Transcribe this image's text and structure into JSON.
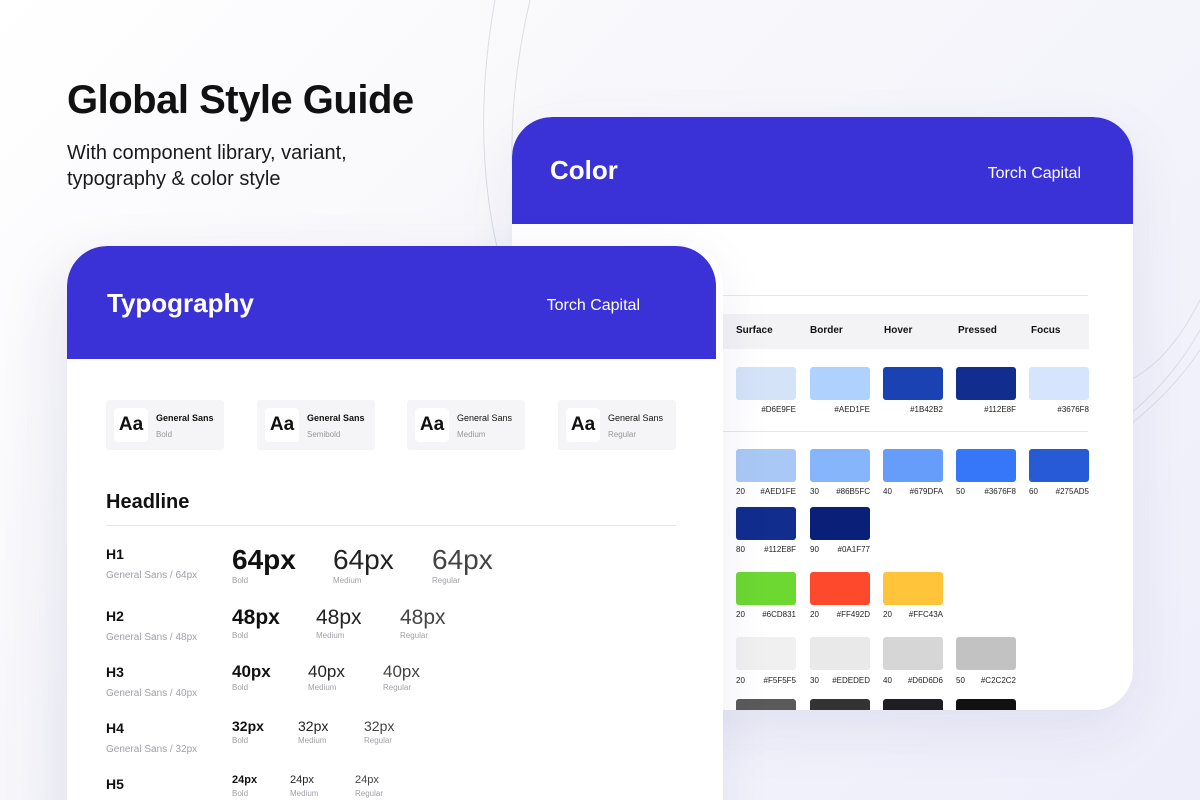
{
  "hero": {
    "title": "Global Style Guide",
    "subtitle_line1": "With component library, variant,",
    "subtitle_line2": "typography & color style"
  },
  "colors": {
    "brand_blue": "#3a32d6"
  },
  "color_card": {
    "title": "Color",
    "brand": "Torch Capital",
    "columns": [
      "Surface",
      "Border",
      "Hover",
      "Pressed",
      "Focus"
    ],
    "state_row": [
      {
        "hex": "#D6E9FE",
        "color": "#d4e3f8"
      },
      {
        "hex": "#AED1FE",
        "color": "#aed1fe"
      },
      {
        "hex": "#1B42B2",
        "color": "#1b42b2"
      },
      {
        "hex": "#112E8F",
        "color": "#112e8f"
      },
      {
        "hex": "#3676F8",
        "color": "#d6e4fd"
      }
    ],
    "blue_row": [
      {
        "step": "20",
        "hex": "#AED1FE",
        "color": "#aac8f5"
      },
      {
        "step": "30",
        "hex": "#86B5FC",
        "color": "#86b5fc"
      },
      {
        "step": "40",
        "hex": "#679DFA",
        "color": "#679dfa"
      },
      {
        "step": "50",
        "hex": "#3676F8",
        "color": "#3676f8"
      },
      {
        "step": "60",
        "hex": "#275AD5",
        "color": "#275ad5"
      }
    ],
    "blue_row2": [
      {
        "step": "80",
        "hex": "#112E8F",
        "color": "#112e8f"
      },
      {
        "step": "90",
        "hex": "#0A1F77",
        "color": "#0a1f77"
      }
    ],
    "status_row": [
      {
        "step": "20",
        "hex": "#6CD831",
        "color": "#6cd831"
      },
      {
        "step": "20",
        "hex": "#FF492D",
        "color": "#ff492d"
      },
      {
        "step": "20",
        "hex": "#FFC43A",
        "color": "#ffc43a"
      }
    ],
    "gray_row": [
      {
        "step": "20",
        "hex": "#F5F5F5",
        "color": "#f0f0f0"
      },
      {
        "step": "30",
        "hex": "#EDEDED",
        "color": "#e9e9e9"
      },
      {
        "step": "40",
        "hex": "#D6D6D6",
        "color": "#d6d6d6"
      },
      {
        "step": "50",
        "hex": "#C2C2C2",
        "color": "#c2c2c2"
      }
    ],
    "dark_row": [
      {
        "color": "#5a5a5a"
      },
      {
        "color": "#333333"
      },
      {
        "color": "#1e1e22"
      },
      {
        "color": "#111111"
      }
    ]
  },
  "typo_card": {
    "title": "Typography",
    "brand": "Torch Capital",
    "fonts": [
      {
        "aa": "Aa",
        "name": "General Sans",
        "weight": "Bold"
      },
      {
        "aa": "Aa",
        "name": "General Sans",
        "weight": "Semibold"
      },
      {
        "aa": "Aa",
        "name": "General Sans",
        "weight": "Medium"
      },
      {
        "aa": "Aa",
        "name": "General Sans",
        "weight": "Regular"
      }
    ],
    "headline": "Headline",
    "styles": [
      {
        "name": "H1",
        "desc": "General Sans / 64px",
        "sample": "64px"
      },
      {
        "name": "H2",
        "desc": "General Sans / 48px",
        "sample": "48px"
      },
      {
        "name": "H3",
        "desc": "General Sans / 40px",
        "sample": "40px"
      },
      {
        "name": "H4",
        "desc": "General Sans / 32px",
        "sample": "32px"
      },
      {
        "name": "H5",
        "desc": "",
        "sample": "24px"
      }
    ],
    "weights": [
      "Bold",
      "Medium",
      "Regular"
    ]
  }
}
